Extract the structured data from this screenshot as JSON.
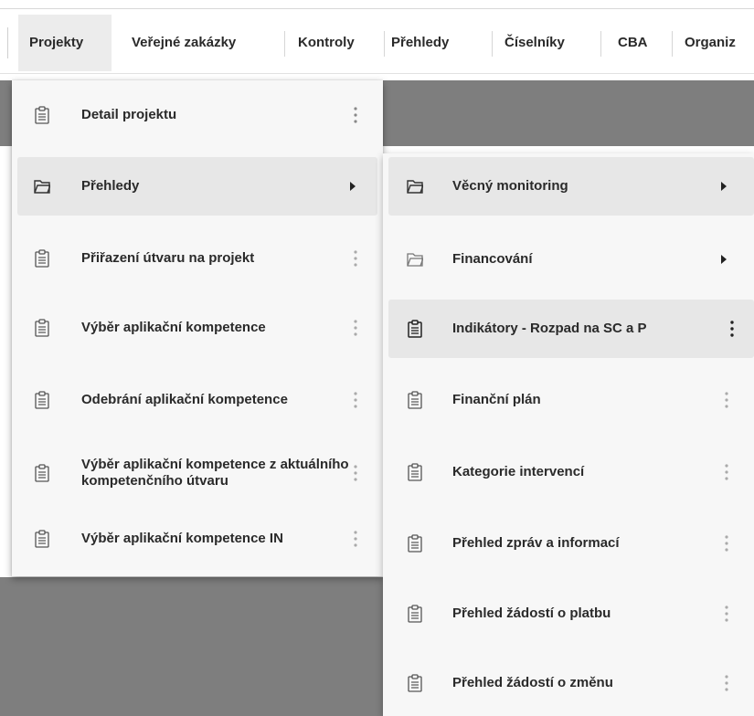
{
  "menubar": {
    "items": [
      {
        "label": "Projekty"
      },
      {
        "label": "Veřejné zakázky"
      },
      {
        "label": "Kontroly"
      },
      {
        "label": "Přehledy"
      },
      {
        "label": "Číselníky"
      },
      {
        "label": "CBA"
      },
      {
        "label": "Organiz"
      }
    ],
    "active_index": 0
  },
  "left_menu": {
    "items": [
      {
        "label": "Detail projektu",
        "icon": "clipboard-icon",
        "trailing": "kebab"
      },
      {
        "label": "Přehledy",
        "icon": "folder-icon",
        "trailing": "arrow",
        "highlighted": true
      },
      {
        "label": "Přiřazení útvaru na projekt",
        "icon": "clipboard-icon",
        "trailing": "kebab"
      },
      {
        "label": "Výběr aplikační kompetence",
        "icon": "clipboard-icon",
        "trailing": "kebab"
      },
      {
        "label": "Odebrání aplikační kompetence",
        "icon": "clipboard-icon",
        "trailing": "kebab"
      },
      {
        "label": "Výběr aplikační kompetence z aktuálního kompetenčního útvaru",
        "icon": "clipboard-icon",
        "trailing": "kebab"
      },
      {
        "label": "Výběr aplikační kompetence IN",
        "icon": "clipboard-icon",
        "trailing": "kebab"
      }
    ]
  },
  "right_menu": {
    "items": [
      {
        "label": "Věcný monitoring",
        "icon": "folder-icon",
        "trailing": "arrow",
        "highlighted": true
      },
      {
        "label": "Financování",
        "icon": "folder-icon",
        "trailing": "arrow"
      },
      {
        "label": "Indikátory - Rozpad na SC a P",
        "icon": "clipboard-icon",
        "trailing": "kebab",
        "highlighted": true
      },
      {
        "label": "Finanční plán",
        "icon": "clipboard-icon",
        "trailing": "kebab"
      },
      {
        "label": "Kategorie intervencí",
        "icon": "clipboard-icon",
        "trailing": "kebab"
      },
      {
        "label": "Přehled zpráv a informací",
        "icon": "clipboard-icon",
        "trailing": "kebab"
      },
      {
        "label": "Přehled žádostí o platbu",
        "icon": "clipboard-icon",
        "trailing": "kebab"
      },
      {
        "label": "Přehled žádostí o změnu",
        "icon": "clipboard-icon",
        "trailing": "kebab"
      }
    ]
  }
}
